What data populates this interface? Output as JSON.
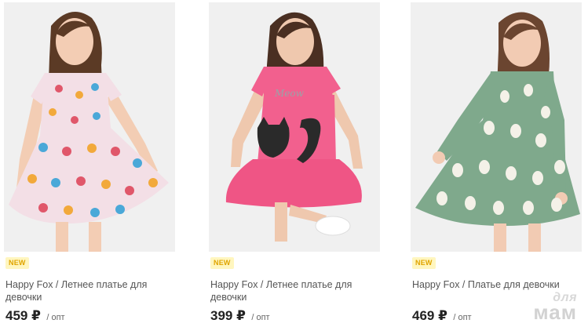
{
  "products": [
    {
      "badge": "NEW",
      "brand": "Happy Fox",
      "separator": " / ",
      "name": "Летнее платье для девочки",
      "price": "459 ₽",
      "price_unit": "/ опт",
      "dress_color": "#f3dfe6"
    },
    {
      "badge": "NEW",
      "brand": "Happy Fox",
      "separator": " / ",
      "name": "Летнее платье для девочки",
      "price": "399 ₽",
      "price_unit": "/ опт",
      "dress_color": "#f2608e"
    },
    {
      "badge": "NEW",
      "brand": "Happy Fox",
      "separator": " / ",
      "name": "Платье для девочки",
      "price": "469 ₽",
      "price_unit": "/ опт",
      "dress_color": "#7fa98c"
    }
  ],
  "watermark": {
    "line1": "для",
    "line2": "мам"
  },
  "colors": {
    "badge_bg": "#fff6bf",
    "badge_text": "#e0a400",
    "photo_bg": "#f0f0f0"
  }
}
